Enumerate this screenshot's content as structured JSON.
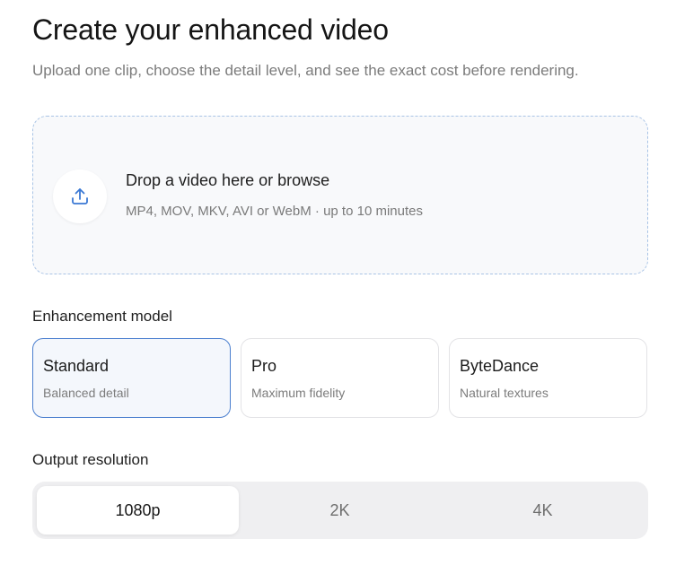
{
  "header": {
    "title": "Create your enhanced video",
    "subtitle": "Upload one clip, choose the detail level, and see the exact cost before rendering."
  },
  "upload": {
    "icon": "upload-icon",
    "title": "Drop a video here or browse",
    "hint": "MP4, MOV, MKV, AVI or WebM · up to 10 minutes"
  },
  "model": {
    "label": "Enhancement model",
    "selected": "Standard",
    "options": [
      {
        "name": "Standard",
        "desc": "Balanced detail"
      },
      {
        "name": "Pro",
        "desc": "Maximum fidelity"
      },
      {
        "name": "ByteDance",
        "desc": "Natural textures"
      }
    ]
  },
  "resolution": {
    "label": "Output resolution",
    "selected": "1080p",
    "options": [
      "1080p",
      "2K",
      "4K"
    ]
  },
  "colors": {
    "accent": "#4b7fcf",
    "dropzone_border": "#a9c4e6",
    "upload_icon": "#3a78d4"
  }
}
